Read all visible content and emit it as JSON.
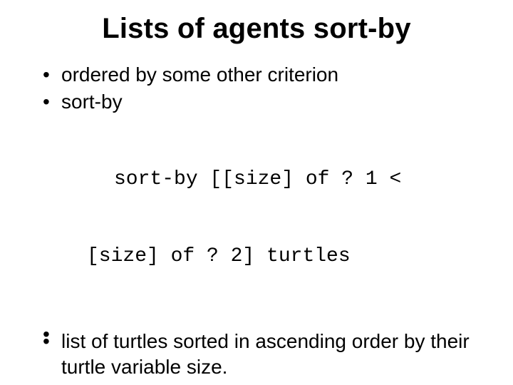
{
  "title": "Lists of agents sort-by",
  "bullets": {
    "b1": "ordered by some other criterion",
    "b2": "sort-by",
    "code1": "sort-by [[size] of ? 1 <",
    "code2": "[size] of ? 2] turtles",
    "b3": "list of turtles sorted in ascending order by their turtle variable size."
  }
}
